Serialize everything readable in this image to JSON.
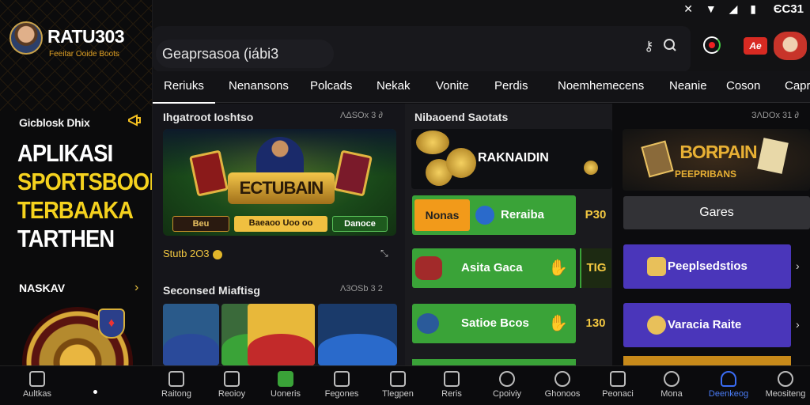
{
  "brand": {
    "name": "RATU303",
    "subtitle": "Feeitar Ooide Boots"
  },
  "status": {
    "time": "ЄC31"
  },
  "search": {
    "value": "Geaprsasoa (iábi3"
  },
  "tabs": [
    "Reriuks",
    "Nenansons",
    "Polcads",
    "Nekak",
    "Vonite",
    "Perdis",
    "Noemhemecens",
    "Neanie",
    "Coson",
    "Capr"
  ],
  "left": {
    "promo_label": "Gicblosk Dhix",
    "hero": [
      "APLIKASI",
      "SPORTSBOOK",
      "TERBAAKA",
      "TARTHEN"
    ],
    "link": "NASKAV"
  },
  "featured": {
    "title": "Ihgatroot Ioshtso",
    "meta": "ΛΔSOx 3 ∂",
    "logo": "ECTUBAIN",
    "buttons": [
      "Beu eocerooo",
      "Baeaoo Uoo oo",
      "Danoce"
    ],
    "stats": "Stutb 2O3"
  },
  "second": {
    "title": "Seconsed Miaftisg",
    "meta": "Λ3OSb 3 2"
  },
  "middle": {
    "title": "Nibaoend Saotats",
    "coins_title": "RAKNAIDIN",
    "rows": [
      {
        "tag": "Nonas",
        "label": "Reraiba",
        "odds": "P30"
      },
      {
        "label": "Asita Gaca",
        "odds": "TIG"
      },
      {
        "label": "Satioe Bcos",
        "odds": "130"
      }
    ]
  },
  "right": {
    "meta": "ЗΛDOx 31 ∂",
    "logo": "BORPAIN",
    "logo_sub": "PEEPRIBANS",
    "games": "Gares",
    "rows": [
      "Peeplsedstios",
      "Varacia Raite"
    ]
  },
  "bottom_nav": [
    {
      "label": "Aultkas",
      "active": false
    },
    {
      "label": "Raitong",
      "active": false
    },
    {
      "label": "Reoioy",
      "active": false
    },
    {
      "label": "Uoneris",
      "active": false
    },
    {
      "label": "Fegones",
      "active": false
    },
    {
      "label": "Tlegpen",
      "active": false
    },
    {
      "label": "Reris",
      "active": false
    },
    {
      "label": "Cpoiviy",
      "active": false
    },
    {
      "label": "Ghonoos",
      "active": false
    },
    {
      "label": "Peonaci",
      "active": false
    },
    {
      "label": "Mona",
      "active": false
    },
    {
      "label": "Deenkeog",
      "active": true
    },
    {
      "label": "Meositeng",
      "active": false
    }
  ],
  "colors": {
    "accent_green": "#3aa338",
    "accent_orange": "#f29a1a",
    "accent_purple": "#4a36ba",
    "gold": "#f3c841",
    "active_blue": "#4a7cf6"
  }
}
